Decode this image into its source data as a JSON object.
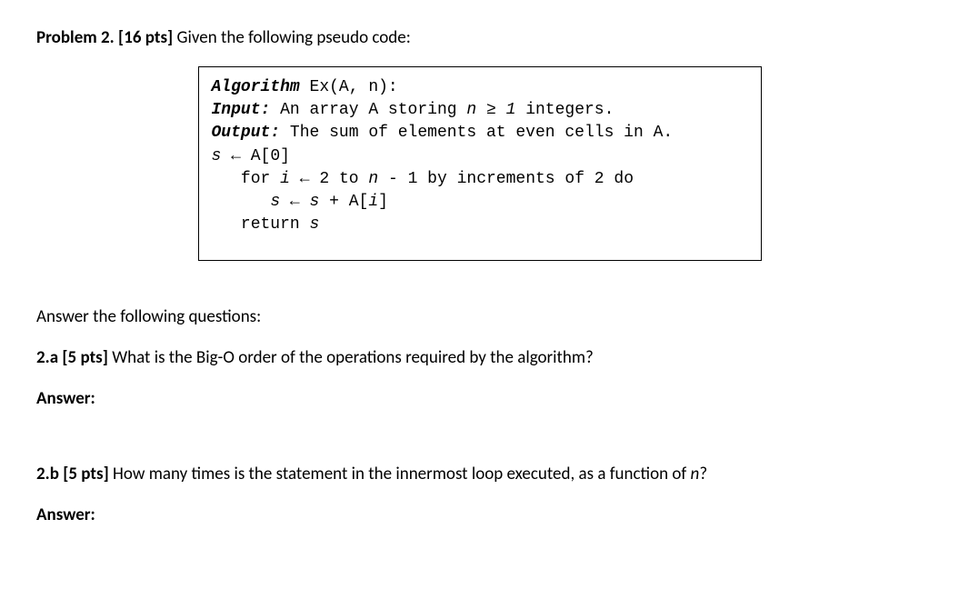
{
  "problem": {
    "number": "Problem 2. [16 pts]",
    "intro": "  Given the following pseudo code:"
  },
  "code": {
    "line1_kw": "Algorithm",
    "line1_rest": " Ex(A, n):",
    "line2_kw": "Input:",
    "line2_rest1": " An array A storing ",
    "line2_n": "n",
    "line2_rest2": " ≥ ",
    "line2_one": "1",
    "line2_rest3": " integers.",
    "line3_kw": "Output:",
    "line3_rest": " The sum of elements at even cells in A.",
    "line4_s": "s",
    "line4_rest": " ← A[0]",
    "line5_pre": "   for ",
    "line5_i": "i",
    "line5_mid": " ← 2 to ",
    "line5_n": "n",
    "line5_rest": " - 1 by increments of 2 do",
    "line6_pre": "      ",
    "line6_s1": "s",
    "line6_mid": " ← ",
    "line6_s2": "s",
    "line6_plus": " + A[",
    "line6_i": "i",
    "line6_close": "]",
    "line7_pre": "   return ",
    "line7_s": "s"
  },
  "followup": "Answer the following questions:",
  "q2a": {
    "label": "2.a [5 pts]",
    "text": "  What is the Big-O order of the operations required by the algorithm?"
  },
  "q2b": {
    "label": "2.b [5 pts]",
    "text1": "   How many times is the statement in the innermost loop executed, as a function of ",
    "text_n": "n",
    "text2": "?"
  },
  "answer_label": "Answer:"
}
